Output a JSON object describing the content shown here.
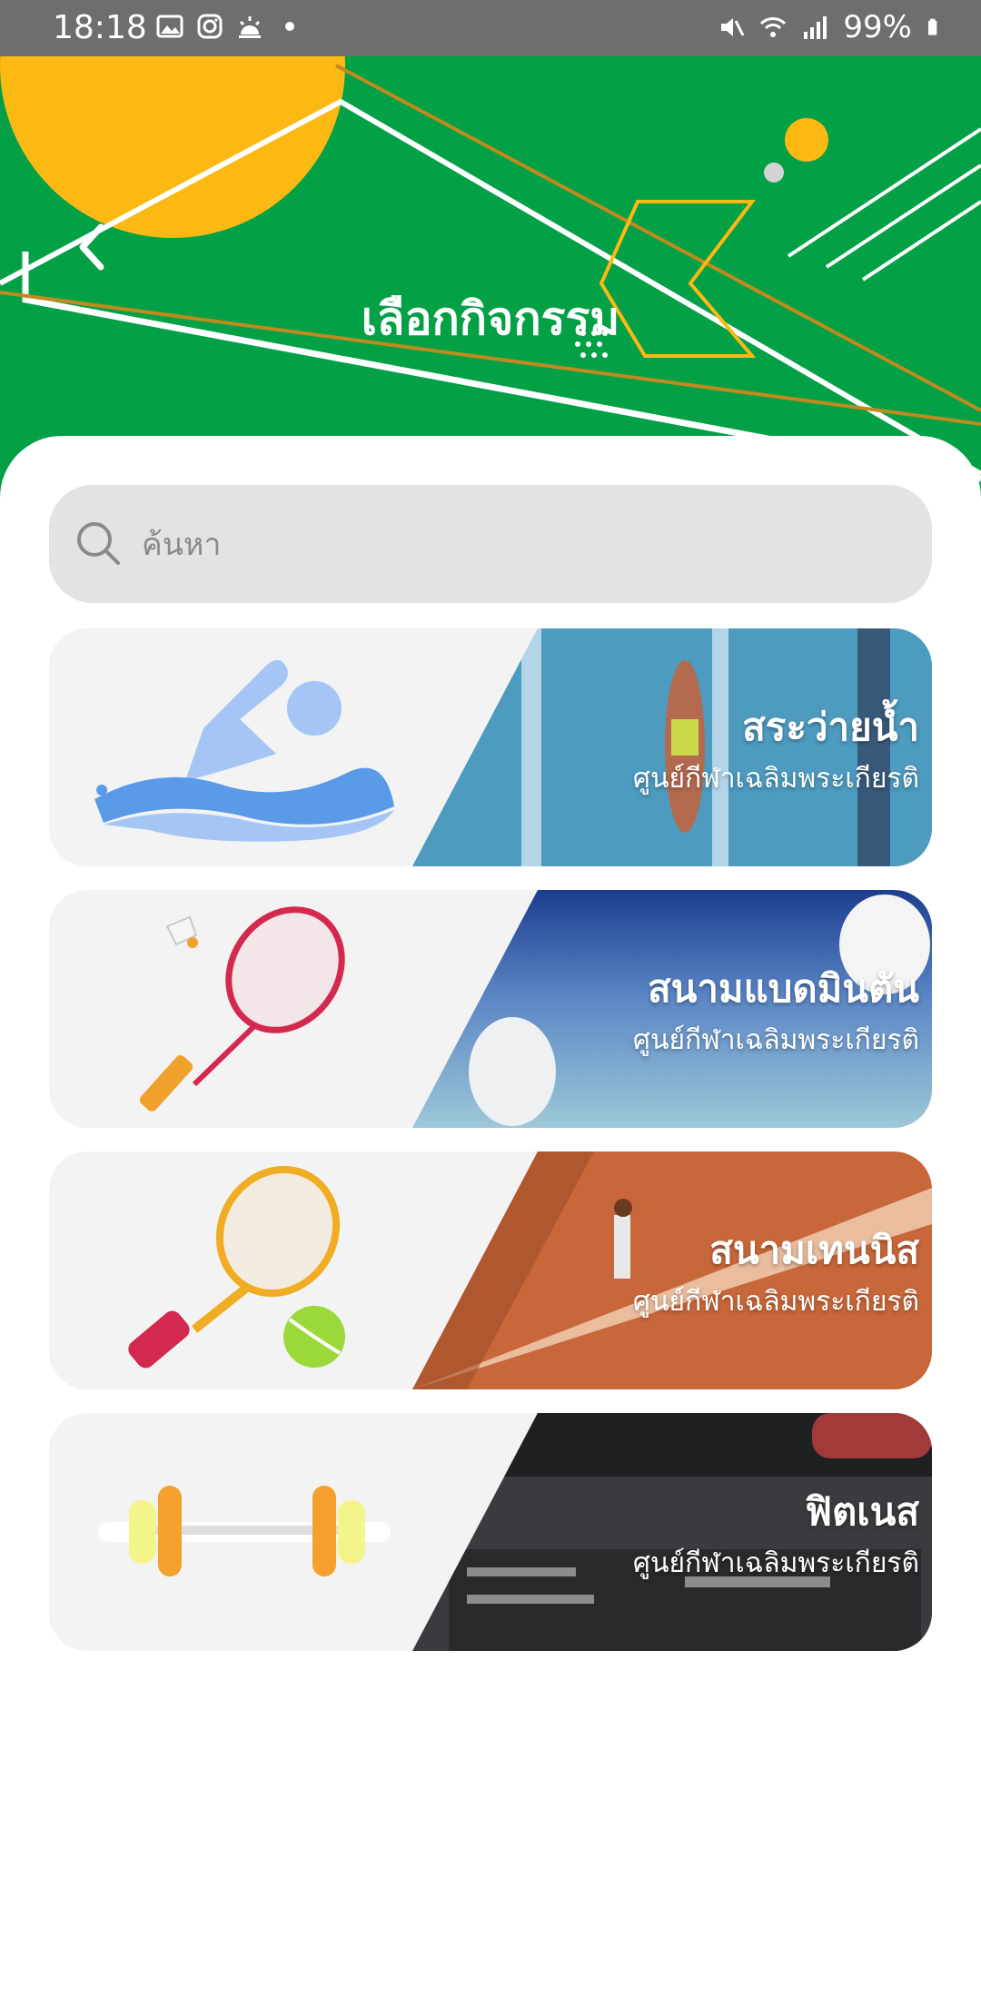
{
  "status_bar": {
    "time": "18:18",
    "left_icons": [
      "gallery-icon",
      "instagram-icon",
      "weather-icon",
      "dot-icon"
    ],
    "right_icons": [
      "mute-icon",
      "wifi-icon",
      "signal-icon",
      "battery-icon"
    ],
    "battery": "99%"
  },
  "header": {
    "title": "เลือกกิจกรรม",
    "back_icon": "chevron-left-icon",
    "background_color": "#03a046",
    "accent_yellow": "#fdb913"
  },
  "search": {
    "placeholder": "ค้นหา",
    "value": "",
    "icon": "search-icon"
  },
  "activities": [
    {
      "title": "สระว่ายน้ำ",
      "subtitle": "ศูนย์กีฬาเฉลิมพระเกียรติ",
      "icon": "swimmer-icon"
    },
    {
      "title": "สนามแบดมินตัน",
      "subtitle": "ศูนย์กีฬาเฉลิมพระเกียรติ",
      "icon": "badminton-racket-icon"
    },
    {
      "title": "สนามเทนนิส",
      "subtitle": "ศูนย์กีฬาเฉลิมพระเกียรติ",
      "icon": "tennis-racket-icon"
    },
    {
      "title": "ฟิตเนส",
      "subtitle": "ศูนย์กีฬาเฉลิมพระเกียรติ",
      "icon": "dumbbell-icon"
    }
  ]
}
